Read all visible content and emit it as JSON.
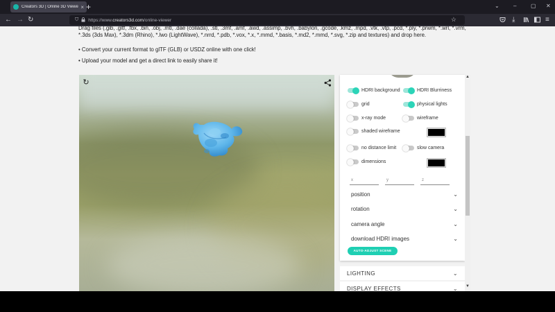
{
  "browser": {
    "tab_title": "Creators 3D | Online 3D Viewer",
    "tab_close": "×",
    "new_tab": "+",
    "url_prefix": "https://www.",
    "url_domain": "creators3d.com",
    "url_path": "/online-viewer",
    "window_buttons": [
      "⌄",
      "–",
      "▢",
      "✕"
    ],
    "nav_icons": [
      "back-icon",
      "forward-icon",
      "reload-icon",
      "shield-icon",
      "lock-icon",
      "bookmark-star-icon",
      "pocket-icon",
      "downloads-icon",
      "library-icon",
      "sidebar-icon",
      "menu-icon"
    ]
  },
  "page": {
    "intro_text": "Drag files (.glb, .gltf, .fbx, .bin, .obj, .mtl, .dae (collada), .stl, .3mf, .amf, .awd, .assimp, .bvh, .babylon, .gcode, .kmz, .mpd, .vtk, .vtp, .pcd, *.ply, *.prwm, *.wrl, *.vrm, *.3ds (3ds Max), *.3dm (Rhino), *.lwo (LightWave), *.nrrd, *.pdb, *.vox, *.x, *.mmd, *.basis, *.md2, *.mmd, *.svg, *.zip and textures) and drop here.",
    "bullets": [
      "• Convert your current format to glTF (GLB) or USDZ online with one click!",
      "• Upload your model and get a direct link to easily share it!"
    ]
  },
  "viewer": {
    "reset_icon": "↻",
    "share_icon": "share-icon",
    "model_color": "#5eb6ea"
  },
  "settings": {
    "toggles": [
      {
        "label": "HDRI background",
        "on": true
      },
      {
        "label": "HDRI Blurriness",
        "on": true
      },
      {
        "label": "grid",
        "on": false
      },
      {
        "label": "physical lights",
        "on": true
      },
      {
        "label": "x-ray mode",
        "on": false
      },
      {
        "label": "wireframe",
        "on": false
      },
      {
        "label": "shaded wireframe",
        "on": false
      },
      {
        "label": "no distance limit",
        "on": false
      },
      {
        "label": "slow camera",
        "on": false
      },
      {
        "label": "dimensions",
        "on": false
      }
    ],
    "swatch_colors": [
      "#000000",
      "#000000"
    ],
    "coords": [
      {
        "placeholder": "x"
      },
      {
        "placeholder": "y"
      },
      {
        "placeholder": "z"
      }
    ],
    "accordions": [
      {
        "label": "position"
      },
      {
        "label": "rotation"
      },
      {
        "label": "camera angle"
      },
      {
        "label": "download HDRI images"
      }
    ],
    "auto_adjust_label": "AUTO-ADJUST SCENE",
    "accent_color": "#1fcfb3"
  },
  "sections": [
    {
      "label": "LIGHTING"
    },
    {
      "label": "DISPLAY EFFECTS"
    }
  ]
}
